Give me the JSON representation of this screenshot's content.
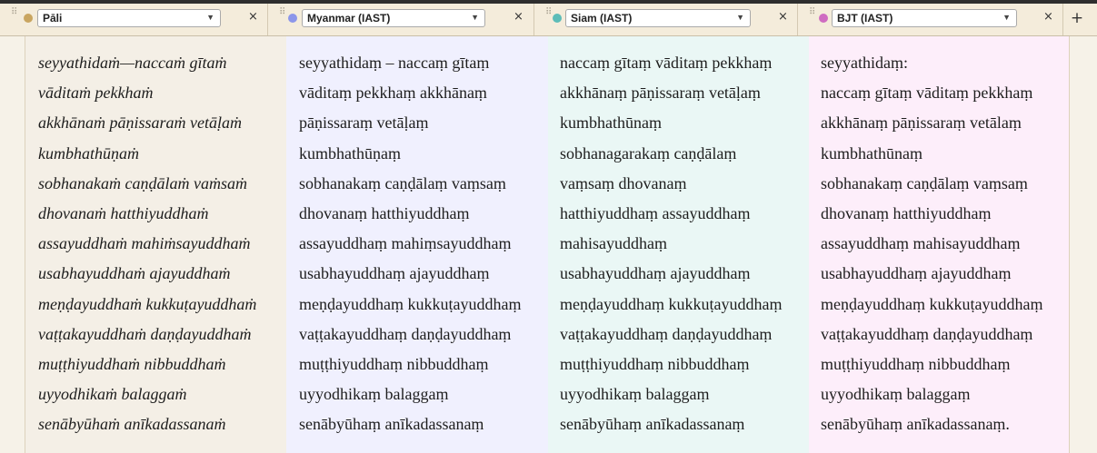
{
  "colors": {
    "pali": "#c9a560",
    "myanmar": "#8c96ea",
    "siam": "#5cbcb8",
    "bjt": "#cf6cc1",
    "bg_pali": "#f4efe6",
    "bg_myanmar": "#f0f0fe",
    "bg_siam": "#eaf7f5",
    "bg_bjt": "#fdeefa"
  },
  "tabs": [
    {
      "label": "Pāli",
      "close": "×",
      "dropdown_icon": "chevron-down-icon"
    },
    {
      "label": "Myanmar (IAST)",
      "close": "×",
      "dropdown_icon": "chevron-down-icon"
    },
    {
      "label": "Siam (IAST)",
      "close": "×",
      "dropdown_icon": "chevron-down-icon"
    },
    {
      "label": "BJT (IAST)",
      "close": "×",
      "dropdown_icon": "chevron-down-icon"
    }
  ],
  "add_tab": "+",
  "columns": {
    "pali": [
      "seyyathidaṁ—naccaṁ gītaṁ",
      "vāditaṁ pekkhaṁ",
      "akkhānaṁ pāṇissaraṁ vetāḷaṁ",
      "kumbhathūṇaṁ",
      "sobhanakaṁ caṇḍālaṁ vaṁsaṁ",
      "dhovanaṁ hatthiyuddhaṁ",
      "assayuddhaṁ mahiṁsayuddhaṁ",
      "usabhayuddhaṁ ajayuddhaṁ",
      "meṇḍayuddhaṁ kukkuṭayuddhaṁ",
      "vaṭṭakayuddhaṁ daṇḍayuddhaṁ",
      "muṭṭhiyuddhaṁ nibbuddhaṁ",
      "uyyodhikaṁ balaggaṁ",
      "senābyūhaṁ anīkadassanaṁ"
    ],
    "myanmar": [
      "seyyathidaṃ – naccaṃ gītaṃ",
      "vāditaṃ pekkhaṃ akkhānaṃ",
      "pāṇissaraṃ vetāḷaṃ",
      "kumbhathūṇaṃ",
      "sobhanakaṃ caṇḍālaṃ vaṃsaṃ",
      "dhovanaṃ hatthiyuddhaṃ",
      "assayuddhaṃ mahiṃsayuddhaṃ",
      "usabhayuddhaṃ ajayuddhaṃ",
      "meṇḍayuddhaṃ kukkuṭayuddhaṃ",
      "vaṭṭakayuddhaṃ daṇḍayuddhaṃ",
      "muṭṭhiyuddhaṃ nibbuddhaṃ",
      "uyyodhikaṃ balaggaṃ",
      "senābyūhaṃ anīkadassanaṃ"
    ],
    "siam": [
      "naccaṃ gītaṃ vāditaṃ pekkhaṃ",
      "akkhānaṃ pāṇissaraṃ vetāḷaṃ",
      "kumbhathūnaṃ",
      "sobhanagarakaṃ caṇḍālaṃ",
      "vaṃsaṃ dhovanaṃ",
      "hatthiyuddhaṃ assayuddhaṃ",
      "mahisayuddhaṃ",
      "usabhayuddhaṃ ajayuddhaṃ",
      "meṇḍayuddhaṃ kukkuṭayuddhaṃ",
      "vaṭṭakayuddhaṃ daṇḍayuddhaṃ",
      "muṭṭhiyuddhaṃ nibbuddhaṃ",
      "uyyodhikaṃ balaggaṃ",
      "senābyūhaṃ anīkadassanaṃ"
    ],
    "bjt": [
      "seyyathidaṃ:",
      "naccaṃ gītaṃ vāditaṃ pekkhaṃ",
      "akkhānaṃ pāṇissaraṃ vetālaṃ",
      "kumbhathūnaṃ",
      "sobhanakaṃ caṇḍālaṃ vaṃsaṃ",
      "dhovanaṃ hatthiyuddhaṃ",
      "assayuddhaṃ mahisayuddhaṃ",
      "usabhayuddhaṃ ajayuddhaṃ",
      "meṇḍayuddhaṃ kukkuṭayuddhaṃ",
      "vaṭṭakayuddhaṃ daṇḍayuddhaṃ",
      "muṭṭhiyuddhaṃ nibbuddhaṃ",
      "uyyodhikaṃ balaggaṃ",
      "senābyūhaṃ anīkadassanaṃ."
    ]
  }
}
